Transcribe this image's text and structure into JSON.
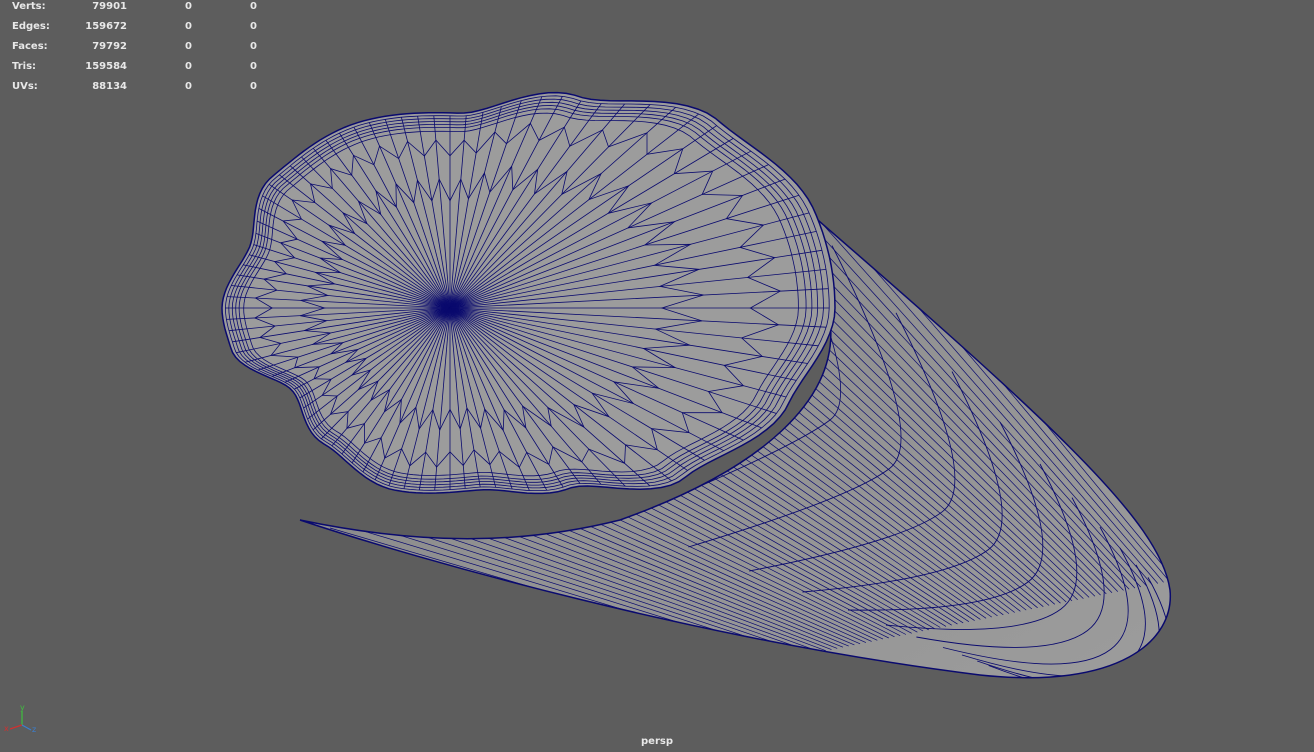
{
  "stats": [
    {
      "label": "Verts:",
      "total": "79901",
      "selected": "0",
      "extra": "0"
    },
    {
      "label": "Edges:",
      "total": "159672",
      "selected": "0",
      "extra": "0"
    },
    {
      "label": "Faces:",
      "total": "79792",
      "selected": "0",
      "extra": "0"
    },
    {
      "label": "Tris:",
      "total": "159584",
      "selected": "0",
      "extra": "0"
    },
    {
      "label": "UVs:",
      "total": "88134",
      "selected": "0",
      "extra": "0"
    }
  ],
  "camera_label": "persp",
  "axis": {
    "y": "y",
    "x": "x",
    "z": "z"
  },
  "colors": {
    "background": "#5d5d5d",
    "mesh_fill": "#9c9c9c",
    "wireframe": "#0a0a6e",
    "text": "#e8e8e8"
  }
}
